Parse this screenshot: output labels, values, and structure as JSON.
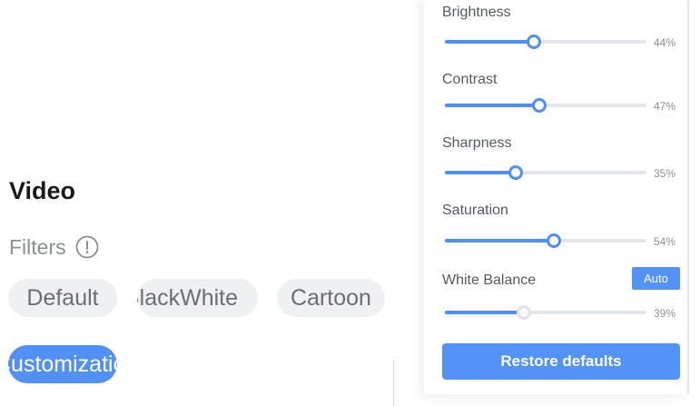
{
  "video": {
    "title": "Video",
    "filters_label": "Filters",
    "filters": [
      {
        "label": "Default",
        "selected": false
      },
      {
        "label": "BlackWhite",
        "selected": false
      },
      {
        "label": "Cartoon",
        "selected": false
      },
      {
        "label": "Customization",
        "selected": true
      }
    ]
  },
  "adjustments": {
    "sliders": [
      {
        "label": "Brightness",
        "value": 44,
        "value_text": "44%"
      },
      {
        "label": "Contrast",
        "value": 47,
        "value_text": "47%"
      },
      {
        "label": "Sharpness",
        "value": 35,
        "value_text": "35%"
      },
      {
        "label": "Saturation",
        "value": 54,
        "value_text": "54%"
      },
      {
        "label": "White Balance",
        "value": 39,
        "value_text": "39%",
        "disabled": true
      }
    ],
    "auto_label": "Auto",
    "restore_label": "Restore defaults"
  },
  "colors": {
    "accent": "#4e8ff6",
    "chip_bg": "#eef0f2",
    "track": "#e3e7ec"
  },
  "icons": {
    "filters_info": "info-circle-icon"
  }
}
